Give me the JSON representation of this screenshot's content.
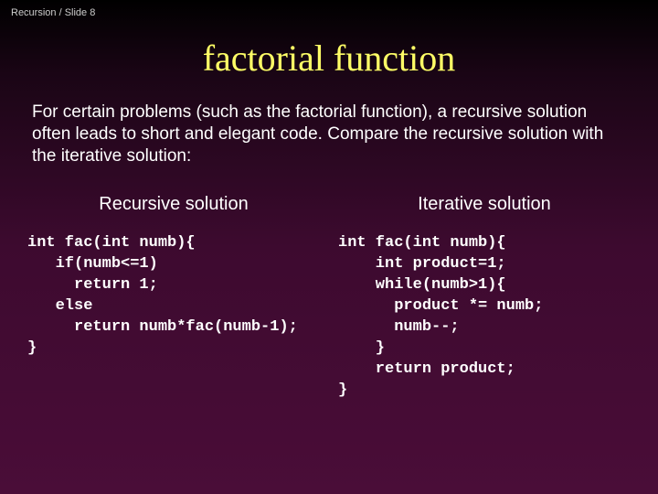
{
  "breadcrumb": "Recursion / Slide 8",
  "title": "factorial function",
  "intro": "For certain problems (such as the factorial function), a recursive solution often leads to short and elegant code. Compare the recursive solution with the iterative solution:",
  "left": {
    "heading": "Recursive solution",
    "code": "int fac(int numb){\n   if(numb<=1)\n     return 1;\n   else\n     return numb*fac(numb-1);\n}"
  },
  "right": {
    "heading": "Iterative solution",
    "code": "int fac(int numb){\n    int product=1;\n    while(numb>1){\n      product *= numb;\n      numb--;\n    }\n    return product;\n}"
  }
}
